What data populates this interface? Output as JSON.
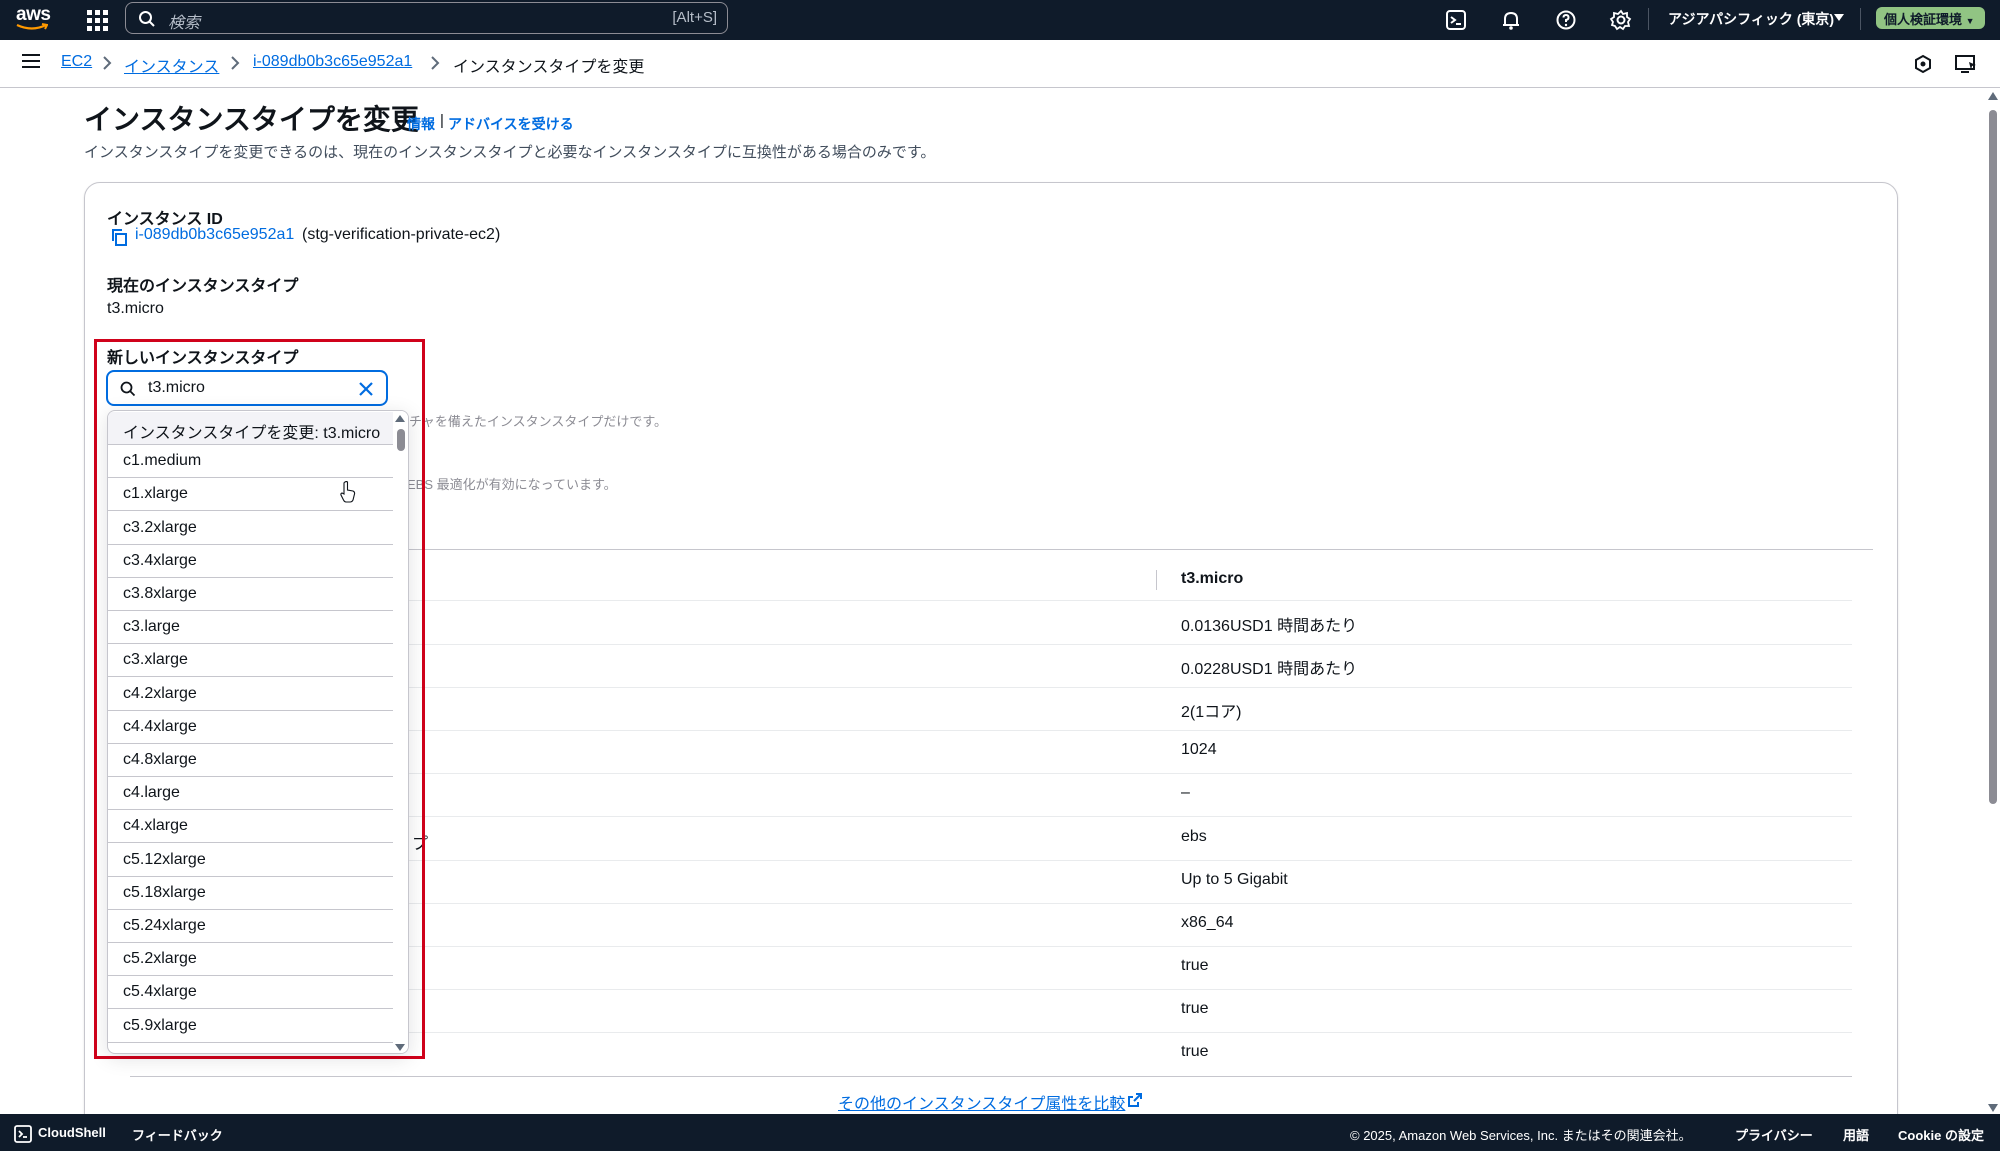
{
  "topnav": {
    "logo_text": "aws",
    "search_placeholder": "検索",
    "search_shortcut": "[Alt+S]",
    "region": "アジアパシフィック (東京)",
    "environment_badge": "個人検証環境"
  },
  "breadcrumb": {
    "items": [
      "EC2",
      "インスタンス",
      "i-089db0b3c65e952a1"
    ],
    "current": "インスタンスタイプを変更"
  },
  "header": {
    "title": "インスタンスタイプを変更",
    "info_link": "情報",
    "separator": "|",
    "advice_link": "アドバイスを受ける",
    "description": "インスタンスタイプを変更できるのは、現在のインスタンスタイプと必要なインスタンスタイプに互換性がある場合のみです。"
  },
  "instance": {
    "id_label": "インスタンス ID",
    "id_value": "i-089db0b3c65e952a1",
    "id_name": "(stg-verification-private-ec2)",
    "current_type_label": "現在のインスタンスタイプ",
    "current_type_value": "t3.micro"
  },
  "new_type": {
    "label": "新しいインスタンスタイプ",
    "input_value": "t3.micro",
    "options": [
      "インスタンスタイプを変更: t3.micro",
      "c1.medium",
      "c1.xlarge",
      "c3.2xlarge",
      "c3.4xlarge",
      "c3.8xlarge",
      "c3.large",
      "c3.xlarge",
      "c4.2xlarge",
      "c4.4xlarge",
      "c4.8xlarge",
      "c4.large",
      "c4.xlarge",
      "c5.12xlarge",
      "c5.18xlarge",
      "c5.24xlarge",
      "c5.2xlarge",
      "c5.4xlarge",
      "c5.9xlarge"
    ]
  },
  "hidden_text": {
    "architecture_note_fragment": "チャを備えたインスタンスタイプだけです。",
    "ebs_note_fragment": "EBS 最適化が有効になっています。",
    "row_fragment": "プ"
  },
  "comparison": {
    "column_header": "t3.micro",
    "values": [
      "0.0136USD1 時間あたり",
      "0.0228USD1 時間あたり",
      "2(1コア)",
      "1024",
      "–",
      "ebs",
      "Up to 5 Gigabit",
      "x86_64",
      "true",
      "true",
      "true"
    ],
    "compare_link": "その他のインスタンスタイプ属性を比較"
  },
  "footer": {
    "cloudshell": "CloudShell",
    "feedback": "フィードバック",
    "copyright": "© 2025, Amazon Web Services, Inc. またはその関連会社。",
    "privacy": "プライバシー",
    "terms": "用語",
    "cookie": "Cookie の設定"
  }
}
